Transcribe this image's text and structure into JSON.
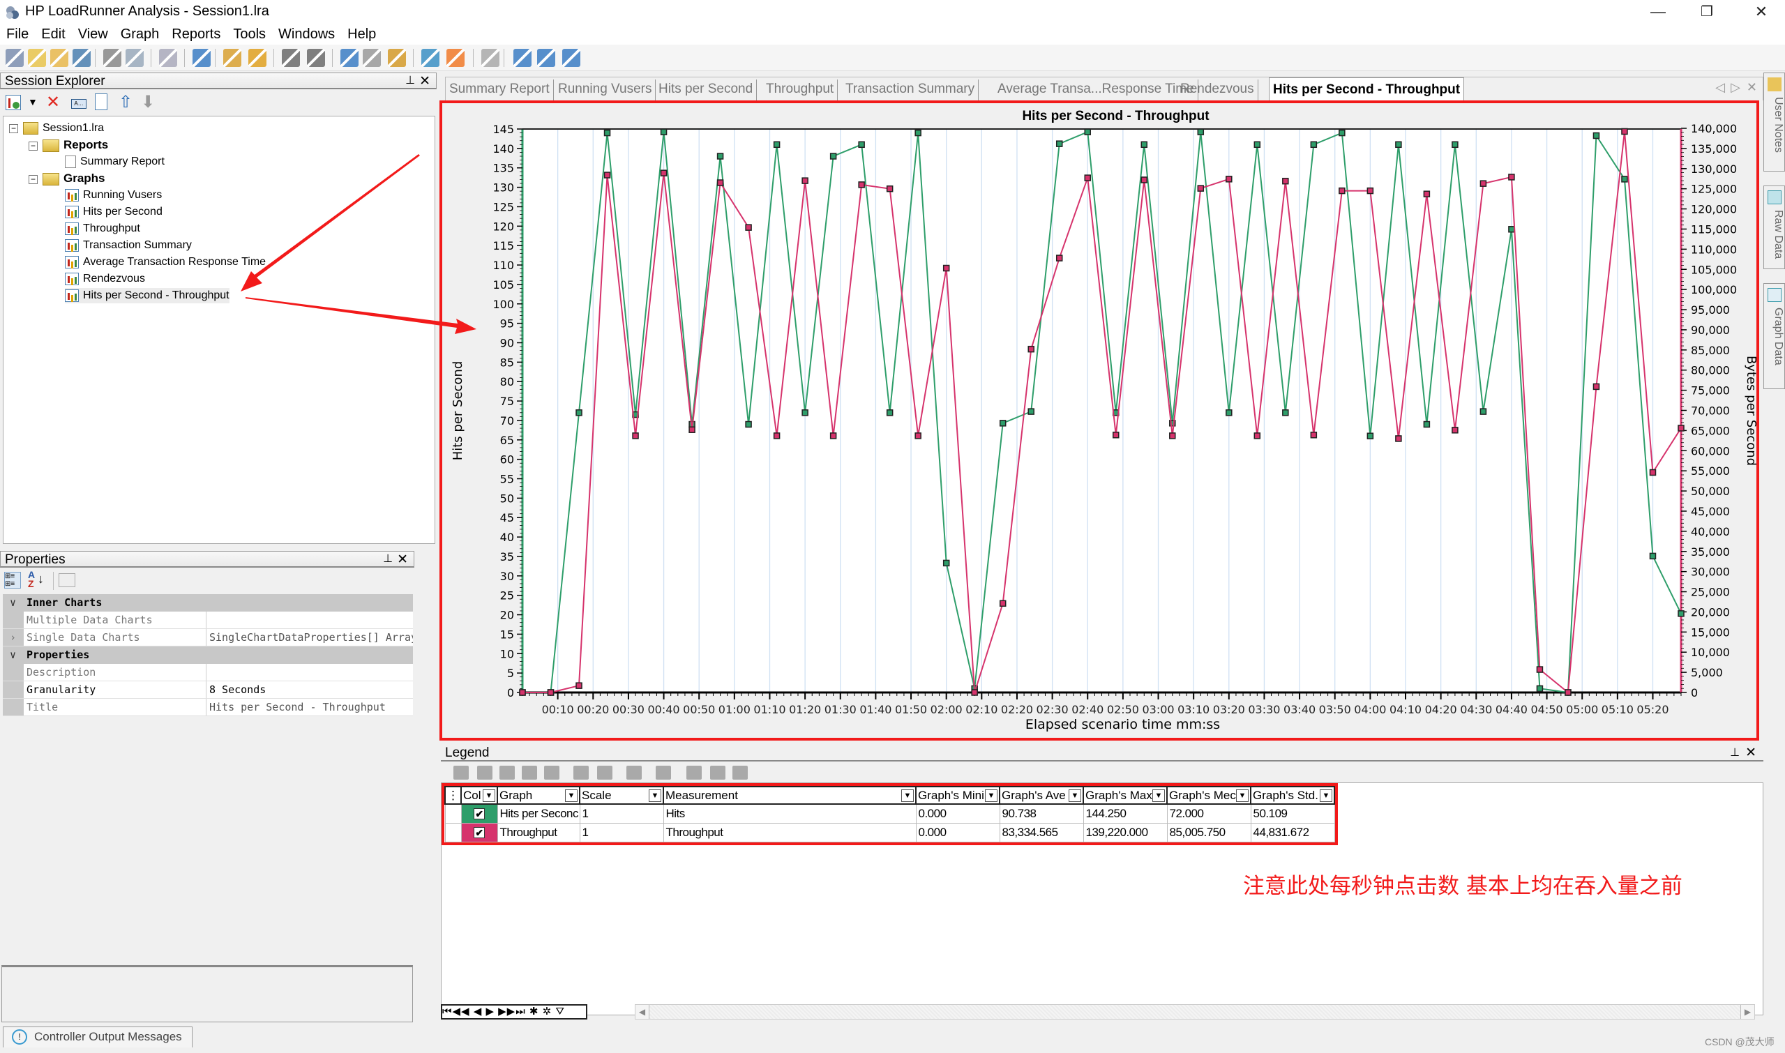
{
  "window": {
    "title": "HP LoadRunner Analysis - Session1.lra",
    "minimize": "—",
    "restore": "❐",
    "close": "✕"
  },
  "menu": [
    "File",
    "Edit",
    "View",
    "Graph",
    "Reports",
    "Tools",
    "Windows",
    "Help"
  ],
  "toolbar_icons": [
    "app-logo-icon",
    "open-icon",
    "new-session-icon",
    "save-icon",
    "print-icon",
    "export-report-icon",
    "copy-graph-icon",
    "filter-icon",
    "cross-result-icon",
    "time-icon",
    "undo-icon",
    "redo-icon",
    "set-filter-icon",
    "clear-filter-icon",
    "group-by-icon",
    "merge-graph-icon",
    "auto-correlate-icon",
    "notes-icon",
    "add-graph-icon",
    "raw-data-icon",
    "graph-data-icon"
  ],
  "session_explorer": {
    "title": "Session Explorer",
    "pin": "📌",
    "close": "✕",
    "root": "Session1.lra",
    "reports_label": "Reports",
    "reports": [
      "Summary Report"
    ],
    "graphs_label": "Graphs",
    "graphs": [
      "Running Vusers",
      "Hits per Second",
      "Throughput",
      "Transaction Summary",
      "Average Transaction Response Time",
      "Rendezvous",
      "Hits per Second - Throughput"
    ],
    "selected": "Hits per Second - Throughput"
  },
  "properties": {
    "title": "Properties",
    "categories": [
      {
        "name": "Inner Charts",
        "rows": [
          {
            "key": "Multiple Data Charts",
            "value": ""
          },
          {
            "key": "Single Data Charts",
            "value": "SingleChartDataProperties[] Array",
            "expandable": true
          }
        ]
      },
      {
        "name": "Properties",
        "rows": [
          {
            "key": "Description",
            "value": ""
          },
          {
            "key": "Granularity",
            "value": "8 Seconds",
            "active": true
          },
          {
            "key": "Title",
            "value": "Hits per Second - Throughput"
          }
        ]
      }
    ]
  },
  "tabs": [
    "Summary Report",
    "Running Vusers",
    "Hits per Second",
    "Throughput",
    "Transaction Summary",
    "Average Transa...Response Time",
    "Rendezvous",
    "Hits per Second - Throughput"
  ],
  "active_tab": "Hits per Second - Throughput",
  "side_tabs": [
    "User Notes",
    "Raw Data",
    "Graph Data"
  ],
  "chart_data": {
    "type": "line",
    "title": "Hits per Second - Throughput",
    "xlabel": "Elapsed scenario time mm:ss",
    "ylabel": "Hits per Second",
    "y2label": "Bytes per Second",
    "x_unit": "seconds",
    "xlim": [
      0,
      328
    ],
    "ylim": [
      0,
      145
    ],
    "y2lim": [
      0,
      140000
    ],
    "grid": true,
    "x_ticks": [
      "00:10",
      "00:20",
      "00:30",
      "00:40",
      "00:50",
      "01:00",
      "01:10",
      "01:20",
      "01:30",
      "01:40",
      "01:50",
      "02:00",
      "02:10",
      "02:20",
      "02:30",
      "02:40",
      "02:50",
      "03:00",
      "03:10",
      "03:20",
      "03:30",
      "03:40",
      "03:50",
      "04:00",
      "04:10",
      "04:20",
      "04:30",
      "04:40",
      "04:50",
      "05:00",
      "05:10",
      "05:20"
    ],
    "y_ticks": [
      0,
      5,
      10,
      15,
      20,
      25,
      30,
      35,
      40,
      45,
      50,
      55,
      60,
      65,
      70,
      75,
      80,
      85,
      90,
      95,
      100,
      105,
      110,
      115,
      120,
      125,
      130,
      135,
      140,
      145
    ],
    "y2_ticks": [
      "0",
      "5,000",
      "10,000",
      "15,000",
      "20,000",
      "25,000",
      "30,000",
      "35,000",
      "40,000",
      "45,000",
      "50,000",
      "55,000",
      "60,000",
      "65,000",
      "70,000",
      "75,000",
      "80,000",
      "85,000",
      "90,000",
      "95,000",
      "100,000",
      "105,000",
      "110,000",
      "115,000",
      "120,000",
      "125,000",
      "130,000",
      "135,000",
      "140,000"
    ],
    "x": [
      0,
      8,
      16,
      24,
      32,
      40,
      48,
      56,
      64,
      72,
      80,
      88,
      96,
      104,
      112,
      120,
      128,
      136,
      144,
      152,
      160,
      168,
      176,
      184,
      192,
      200,
      208,
      216,
      224,
      232,
      240,
      248,
      256,
      264,
      272,
      280,
      288,
      296,
      304,
      312,
      320,
      328
    ],
    "series": [
      {
        "name": "Hits per Second",
        "axis": "left",
        "color": "#2e9e6a",
        "values": [
          0,
          0,
          72,
          144,
          71.5,
          144.25,
          69,
          138,
          69,
          141,
          72,
          138,
          141,
          72,
          144,
          33.3,
          1,
          69.3,
          72.3,
          141.2,
          144.25,
          72,
          141,
          69.3,
          144.25,
          72,
          141,
          72,
          141,
          144,
          66,
          141,
          69,
          141,
          72.3,
          119.2,
          1,
          0,
          143.3,
          132.1,
          35.1,
          20.3
        ]
      },
      {
        "name": "Throughput",
        "axis": "right",
        "color": "#d6336c",
        "values": [
          0,
          0,
          1700,
          128400,
          63700,
          128900,
          65200,
          126500,
          115400,
          63700,
          127000,
          63700,
          126000,
          125000,
          63700,
          105300,
          0,
          22100,
          85200,
          107800,
          127700,
          63900,
          127200,
          63700,
          125100,
          127400,
          63700,
          126900,
          63900,
          124500,
          124500,
          63000,
          123700,
          65100,
          126300,
          127900,
          5700,
          0,
          75900,
          139220,
          54600,
          65600
        ]
      }
    ]
  },
  "legend": {
    "title": "Legend",
    "columns": [
      "Col",
      "Graph",
      "Scale",
      "Measurement",
      "Graph's Mini",
      "Graph's Ave",
      "Graph's Max",
      "Graph's Mec",
      "Graph's Std."
    ],
    "rows": [
      {
        "color": "#2e9e6a",
        "checked": "✔",
        "graph": "Hits per Seconc",
        "scale": "1",
        "measurement": "Hits",
        "min": "0.000",
        "avg": "90.738",
        "max": "144.250",
        "median": "72.000",
        "std": "50.109"
      },
      {
        "color": "#d6336c",
        "checked": "✔",
        "graph": "Throughput",
        "scale": "1",
        "measurement": "Throughput",
        "min": "0.000",
        "avg": "83,334.565",
        "max": "139,220.000",
        "median": "85,005.750",
        "std": "44,831.672"
      }
    ],
    "nav": "⏮◀◀ ◀ ▶ ▶▶⏭ ✱ ✲ ⛛"
  },
  "annotation": "注意此处每秒钟点击数 基本上均在吞入量之前",
  "status": {
    "controller_output": "Controller Output Messages"
  },
  "watermark": "CSDN @茂大师"
}
